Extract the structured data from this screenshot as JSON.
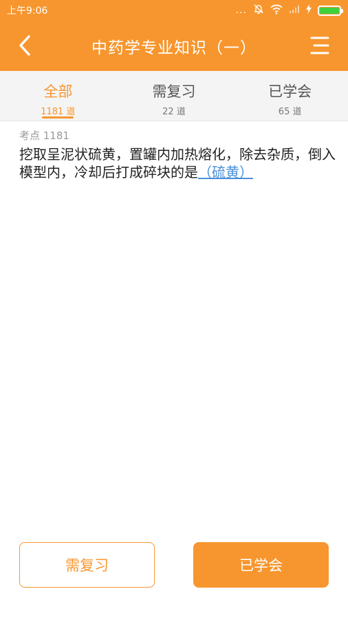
{
  "status_bar": {
    "time": "上午9:06",
    "dots": "...",
    "colors": {
      "battery_fill": "#3fd03f"
    }
  },
  "header": {
    "title": "中药学专业知识（一）",
    "back_icon": "chevron-left-icon",
    "menu_icon": "menu-icon",
    "background": "#f7962e"
  },
  "tabs": [
    {
      "label": "全部",
      "count": "1181 道",
      "active": true
    },
    {
      "label": "需复习",
      "count": "22 道",
      "active": false
    },
    {
      "label": "已学会",
      "count": "65 道",
      "active": false
    }
  ],
  "question": {
    "kaodian": "考点 1181",
    "text": "挖取呈泥状硫黄，置罐内加热熔化，除去杂质，倒入模型内，冷却后打成碎块的是",
    "answer": "（硫黄）"
  },
  "buttons": {
    "review_label": "需复习",
    "learned_label": "已学会"
  }
}
